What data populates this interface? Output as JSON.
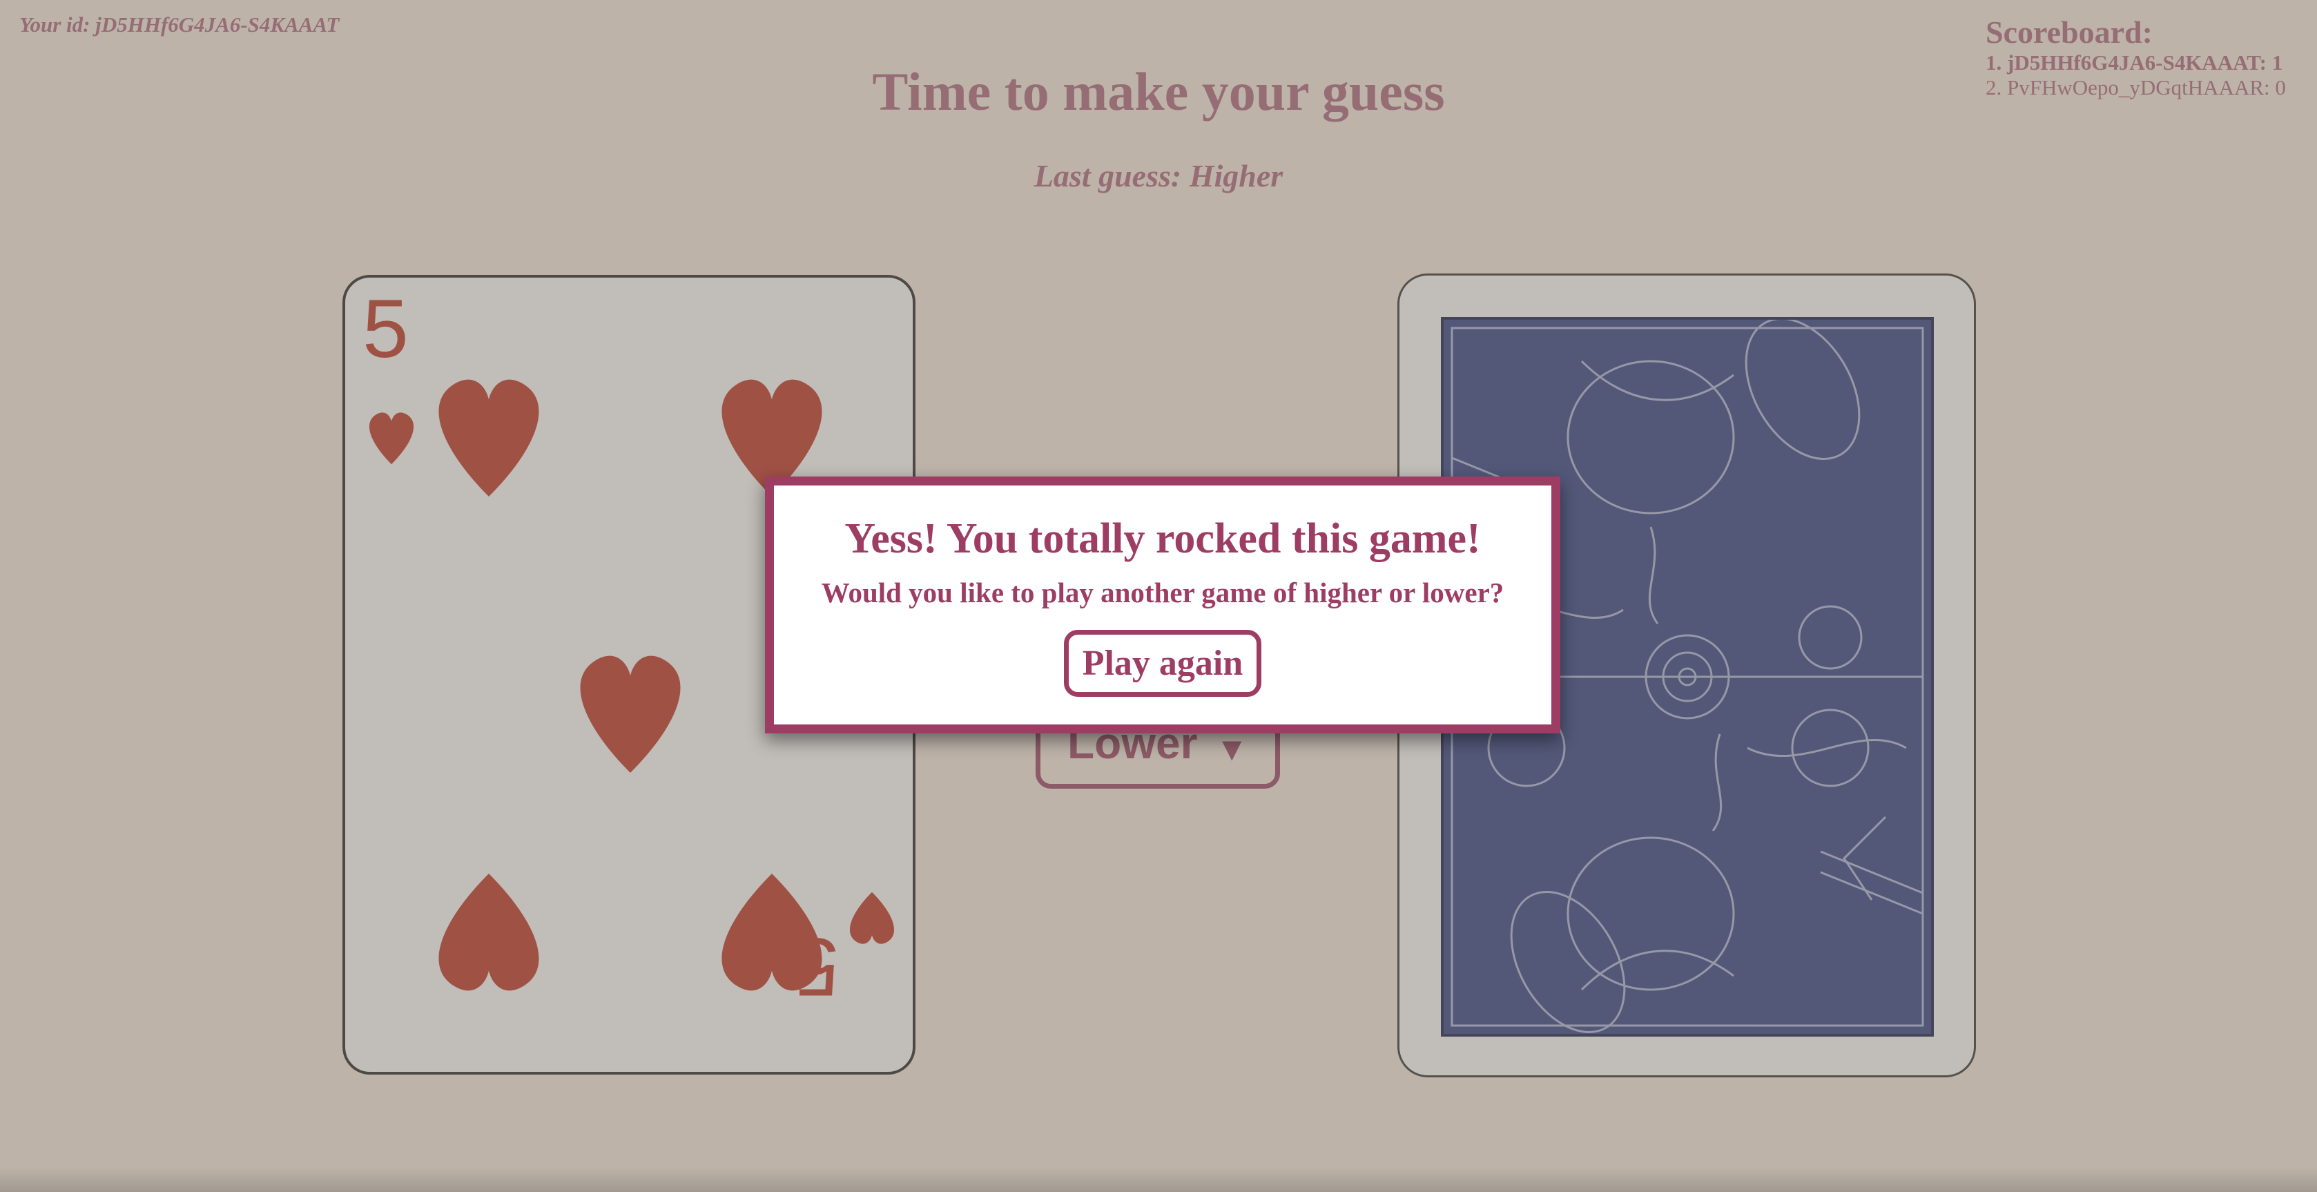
{
  "header": {
    "user_id_label": "Your id: jD5HHf6G4JA6-S4KAAAT",
    "title": "Time to make your guess",
    "last_guess": "Last guess: Higher"
  },
  "scoreboard": {
    "title": "Scoreboard:",
    "entries": [
      "1. jD5HHf6G4JA6-S4KAAAT: 1",
      "2. PvFHwOepo_yDGqtHAAAR: 0"
    ]
  },
  "cards": {
    "face_up": {
      "rank": "5",
      "suit": "hearts",
      "suit_icon": "heart-icon",
      "color": "#c0392b"
    },
    "face_down": {
      "back_color": "#35458a",
      "pattern_icon": "rabbit-illustration-icon"
    }
  },
  "controls": {
    "lower_label": "Lower",
    "lower_arrow": "▼"
  },
  "modal": {
    "title": "Yess! You totally rocked this game!",
    "message": "Would you like to play another game of higher or lower?",
    "play_again_label": "Play again"
  },
  "colors": {
    "accent": "#9e3d63",
    "page_background": "#f6ece2",
    "overlay": "rgba(120,110,100,0.45)"
  }
}
